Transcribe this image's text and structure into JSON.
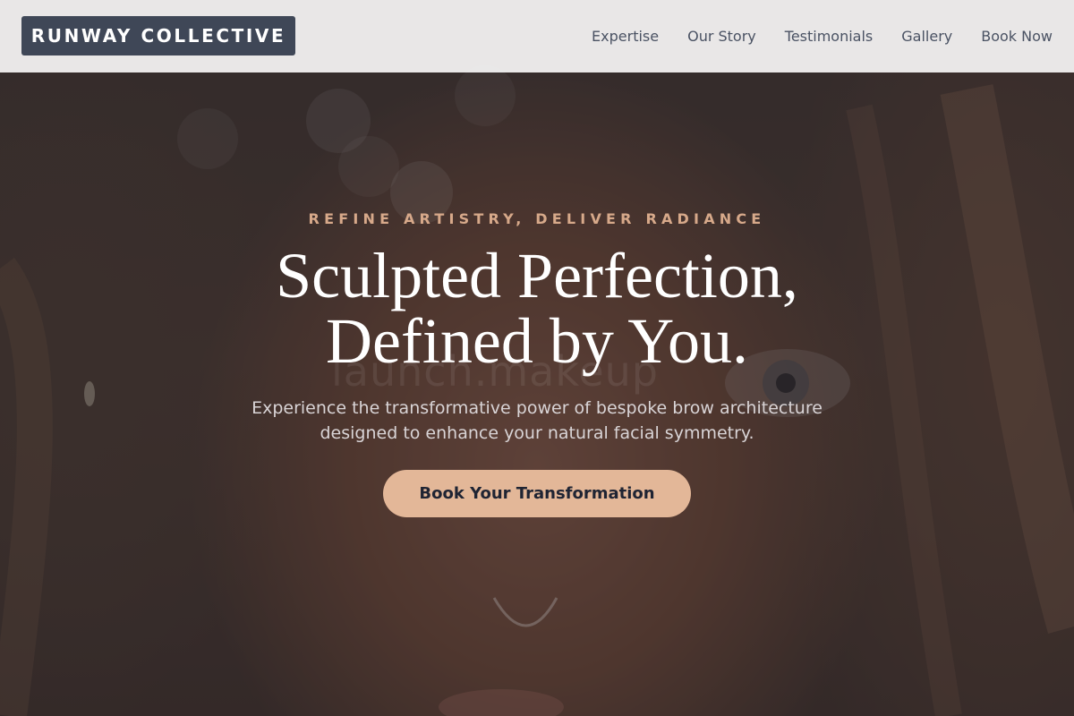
{
  "header": {
    "brand": "RUNWAY COLLECTIVE",
    "nav": [
      {
        "label": "Expertise"
      },
      {
        "label": "Our Story"
      },
      {
        "label": "Testimonials"
      },
      {
        "label": "Gallery"
      },
      {
        "label": "Book Now"
      }
    ]
  },
  "hero": {
    "tagline": "REFINE ARTISTRY, DELIVER RADIANCE",
    "headline_line1": "Sculpted Perfection,",
    "headline_line2": "Defined by You.",
    "description": "Experience the transformative power of bespoke brow architecture designed to enhance your natural facial symmetry.",
    "cta_label": "Book Your Transformation",
    "background_watermark": "launch.makeup"
  },
  "colors": {
    "brand_bg": "#3f4757",
    "accent": "#e3b798",
    "tagline": "#d7a98a",
    "nav_text": "#4a5263"
  }
}
